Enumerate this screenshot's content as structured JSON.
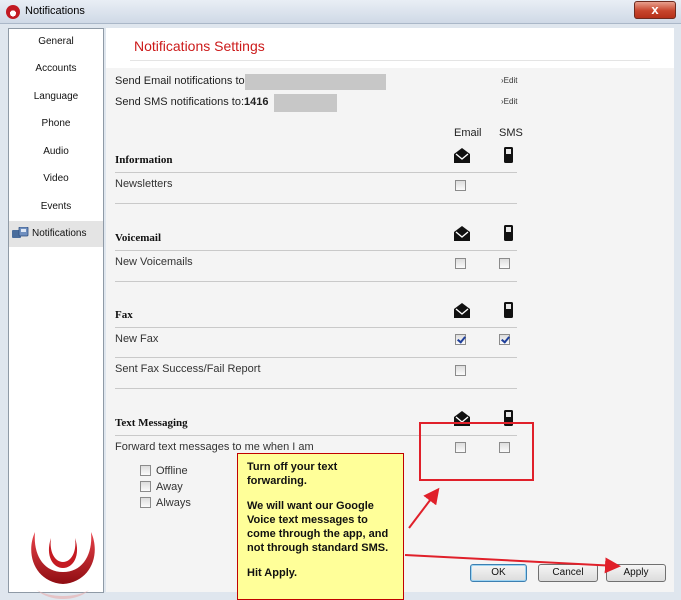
{
  "window": {
    "title": "Notifications",
    "close_glyph": "x"
  },
  "sidebar": {
    "items": [
      {
        "label": "General",
        "active": false
      },
      {
        "label": "Accounts",
        "active": false
      },
      {
        "label": "Language",
        "active": false
      },
      {
        "label": "Phone",
        "active": false
      },
      {
        "label": "Audio",
        "active": false
      },
      {
        "label": "Video",
        "active": false
      },
      {
        "label": "Events",
        "active": false
      },
      {
        "label": "Notifications",
        "active": true,
        "icon": "notifications-icon"
      }
    ]
  },
  "main": {
    "title": "Notifications Settings",
    "email_line": {
      "label": "Send Email notifications to:",
      "value": "",
      "edit": "›Edit"
    },
    "sms_line": {
      "label": "Send SMS notifications to:",
      "value": "1416",
      "edit": "›Edit"
    },
    "columns": {
      "email": "Email",
      "sms": "SMS"
    },
    "sections": [
      {
        "title": "Information",
        "rows": [
          {
            "label": "Newsletters",
            "email": false,
            "sms": null
          }
        ]
      },
      {
        "title": "Voicemail",
        "rows": [
          {
            "label": "New Voicemails",
            "email": false,
            "sms": false
          }
        ]
      },
      {
        "title": "Fax",
        "rows": [
          {
            "label": "New Fax",
            "email": true,
            "sms": true
          },
          {
            "label": "Sent Fax Success/Fail Report",
            "email": false,
            "sms": null
          }
        ]
      },
      {
        "title": "Text Messaging",
        "rows": [
          {
            "label": "Forward text messages to me when I am",
            "email": false,
            "sms": false
          }
        ],
        "options": [
          {
            "label": "Offline",
            "checked": false
          },
          {
            "label": "Away",
            "checked": false
          },
          {
            "label": "Always",
            "checked": false
          }
        ]
      }
    ],
    "icons": {
      "email": "envelope-icon",
      "sms": "mobile-phone-icon"
    }
  },
  "buttons": {
    "ok": "OK",
    "cancel": "Cancel",
    "apply": "Apply"
  },
  "annotation": {
    "line1": "Turn off your text forwarding.",
    "line2": "We will want our Google Voice text messages to come through the app, and not through standard SMS.",
    "line3": "Hit Apply."
  },
  "colors": {
    "title_red": "#cc1a1a",
    "annotation_bg": "#ffff99",
    "annotation_border": "#e0202a"
  }
}
